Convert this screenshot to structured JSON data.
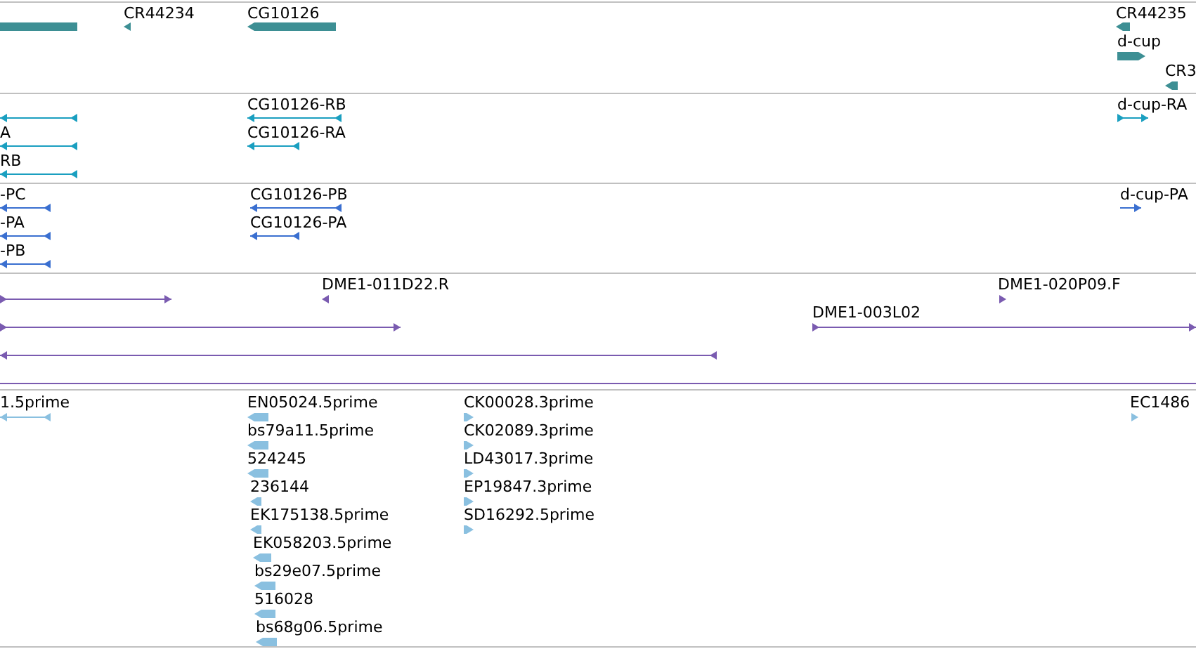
{
  "tracks": [
    {
      "kind": "gene",
      "features": [
        {
          "kind": "bar"
        },
        {
          "kind": "small",
          "label": "CR44234",
          "reverse": true
        },
        {
          "kind": "bar",
          "label": "CG10126",
          "reverse": true
        },
        {
          "kind": "small",
          "label": "CR44235",
          "reverse": true
        },
        {
          "kind": "bar",
          "label": "d-cup",
          "reverse": false
        },
        {
          "kind": "small",
          "label": "CR3",
          "reverse": true
        }
      ]
    },
    {
      "kind": "transcript",
      "features": [
        {
          "kind": "transcript",
          "reverse": true
        },
        {
          "kind": "transcript",
          "label": "A",
          "reverse": true
        },
        {
          "kind": "transcript",
          "label": "RB",
          "reverse": true
        },
        {
          "kind": "transcript",
          "label": "CG10126-RB",
          "reverse": true
        },
        {
          "kind": "transcript",
          "label": "CG10126-RA",
          "reverse": true
        },
        {
          "kind": "transcript",
          "label": "d-cup-RA",
          "reverse": false
        }
      ]
    },
    {
      "kind": "protein",
      "features": [
        {
          "kind": "transcript",
          "label": "-PC",
          "reverse": true
        },
        {
          "kind": "transcript",
          "label": "-PA",
          "reverse": true
        },
        {
          "kind": "transcript",
          "label": "-PB",
          "reverse": true
        },
        {
          "kind": "transcript",
          "label": "CG10126-PB",
          "reverse": true
        },
        {
          "kind": "transcript",
          "label": "CG10126-PA",
          "reverse": true
        },
        {
          "kind": "transcript",
          "label": "d-cup-PA",
          "reverse": false
        }
      ]
    },
    {
      "kind": "clone",
      "features": [
        {
          "kind": "transcript",
          "reverse": false
        },
        {
          "kind": "small",
          "label": "DME1-011D22.R",
          "reverse": true
        },
        {
          "kind": "transcript",
          "reverse": false
        },
        {
          "kind": "transcript",
          "reverse": true
        },
        {
          "kind": "transcript",
          "label": "DME1-003L02",
          "reverse": false
        },
        {
          "kind": "small",
          "label": "DME1-020P09.F",
          "reverse": false
        },
        {
          "kind": "line"
        }
      ]
    },
    {
      "kind": "est",
      "features": [
        {
          "kind": "transcript",
          "label": "1.5prime",
          "reverse": true
        },
        {
          "kind": "small",
          "label": "EN05024.5prime",
          "reverse": true
        },
        {
          "kind": "small",
          "label": "bs79a11.5prime",
          "reverse": true
        },
        {
          "kind": "small",
          "label": "524245",
          "reverse": true
        },
        {
          "kind": "small",
          "label": "236144",
          "reverse": true
        },
        {
          "kind": "small",
          "label": "EK175138.5prime",
          "reverse": true
        },
        {
          "kind": "small",
          "label": "EK058203.5prime",
          "reverse": true
        },
        {
          "kind": "small",
          "label": "bs29e07.5prime",
          "reverse": true
        },
        {
          "kind": "small",
          "label": "516028",
          "reverse": true
        },
        {
          "kind": "small",
          "label": "bs68g06.5prime",
          "reverse": true
        },
        {
          "kind": "small",
          "label": "CK00028.3prime",
          "reverse": false
        },
        {
          "kind": "small",
          "label": "CK02089.3prime",
          "reverse": false
        },
        {
          "kind": "small",
          "label": "LD43017.3prime",
          "reverse": false
        },
        {
          "kind": "small",
          "label": "EP19847.3prime",
          "reverse": false
        },
        {
          "kind": "small",
          "label": "SD16292.5prime",
          "reverse": false
        },
        {
          "kind": "small",
          "label": "EC1486",
          "reverse": false
        }
      ]
    }
  ]
}
